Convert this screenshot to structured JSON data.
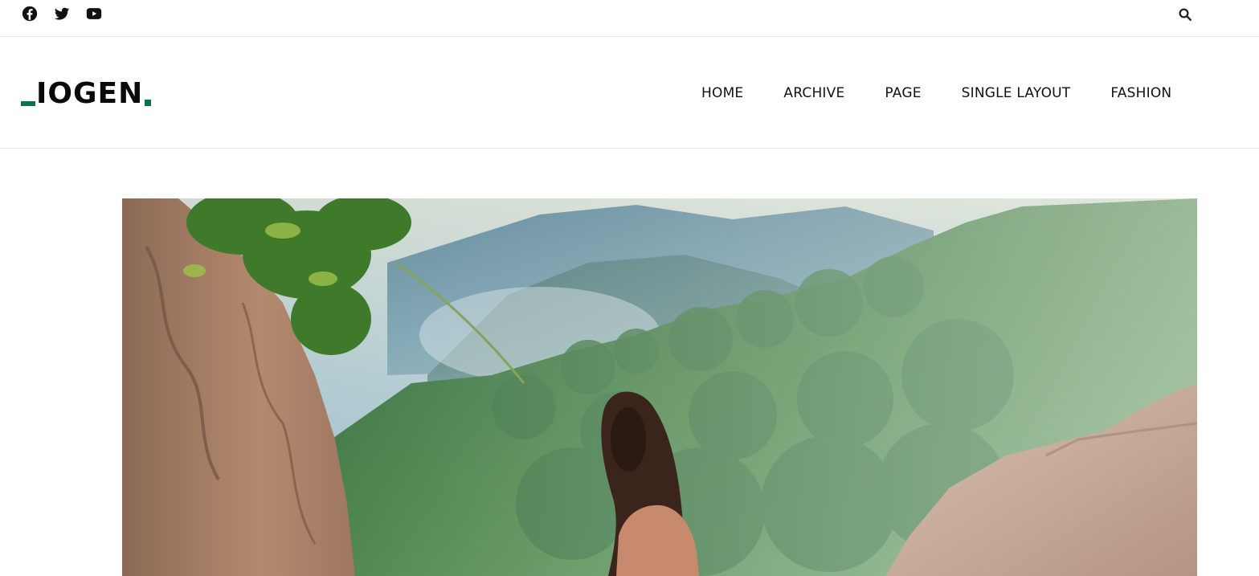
{
  "topbar": {
    "social": [
      {
        "icon": "facebook-icon",
        "label": "Facebook"
      },
      {
        "icon": "twitter-icon",
        "label": "Twitter"
      },
      {
        "icon": "youtube-icon",
        "label": "YouTube"
      }
    ],
    "search_icon": "search-icon"
  },
  "header": {
    "logo_text": "IOGEN",
    "logo_accent_color": "#0f6e4f",
    "nav": [
      "HOME",
      "ARCHIVE",
      "PAGE",
      "SINGLE LAYOUT",
      "FASHION"
    ]
  },
  "hero": {
    "image_alt": "Woman looking over a misty tropical jungle valley from between rocks"
  }
}
